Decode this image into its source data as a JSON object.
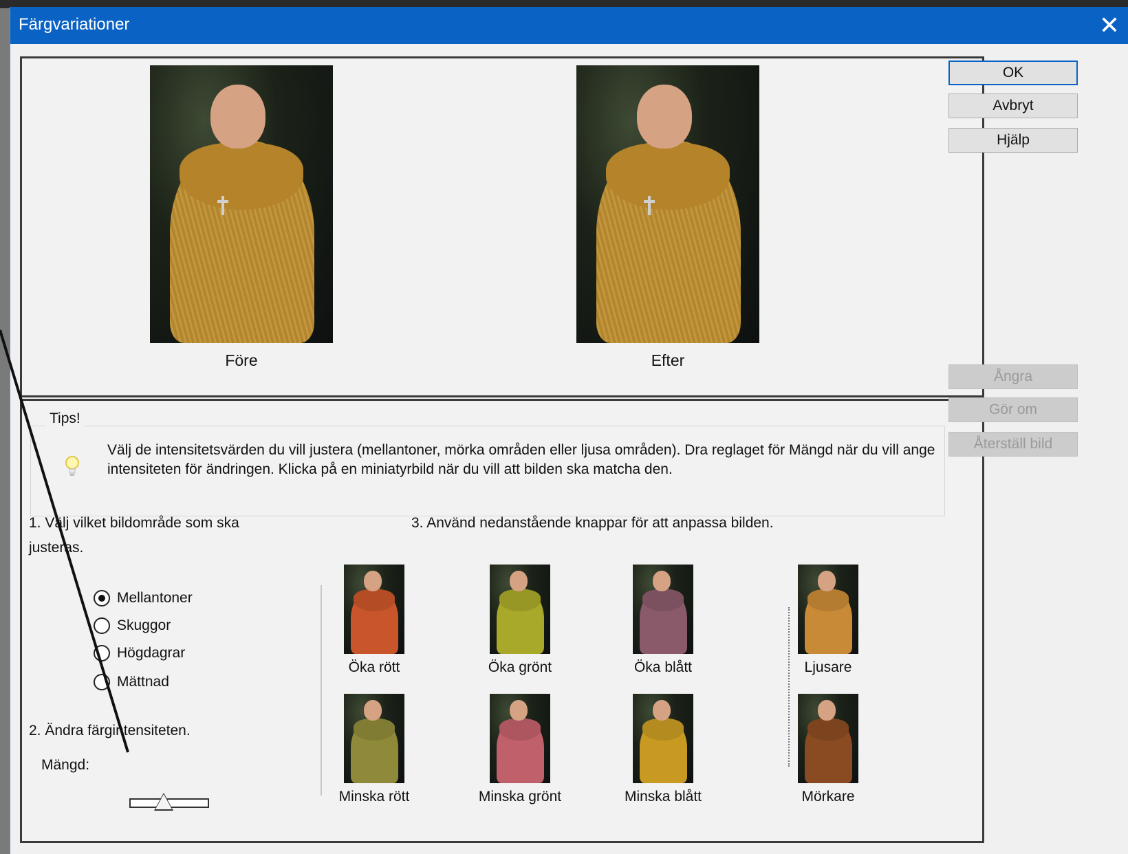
{
  "window": {
    "title": "Färgvariationer"
  },
  "preview": {
    "before_label": "Före",
    "after_label": "Efter"
  },
  "tips": {
    "title": "Tips!",
    "text": "Välj de intensitetsvärden du vill justera (mellantoner, mörka områden eller ljusa områden). Dra reglaget för Mängd när du vill ange intensiteten för ändringen. Klicka på en miniatyrbild när du vill att bilden ska matcha den."
  },
  "step1": {
    "label": "1. Välj vilket bildområde som ska justeras.",
    "options": [
      "Mellantoner",
      "Skuggor",
      "Högdagrar",
      "Mättnad"
    ],
    "selected": "Mellantoner"
  },
  "step2": {
    "label": "2. Ändra färgintensiteten.",
    "amount_label": "Mängd:",
    "amount_value": 0.5
  },
  "step3": {
    "label": "3. Använd nedanstående knappar för att anpassa bilden."
  },
  "thumbnails": [
    {
      "label": "Öka rött",
      "tint": "#c8562a"
    },
    {
      "label": "Öka grönt",
      "tint": "#a8a82a"
    },
    {
      "label": "Öka blått",
      "tint": "#8a5a6a"
    },
    {
      "label": "Ljusare",
      "tint": "#c88a36"
    },
    {
      "label": "Minska rött",
      "tint": "#8e8a3a"
    },
    {
      "label": "Minska grönt",
      "tint": "#c0606a"
    },
    {
      "label": "Minska blått",
      "tint": "#c89a22"
    },
    {
      "label": "Mörkare",
      "tint": "#8a4a22"
    }
  ],
  "buttons": {
    "ok": "OK",
    "cancel": "Avbryt",
    "help": "Hjälp",
    "undo": "Ångra",
    "redo": "Gör om",
    "reset": "Återställ bild"
  }
}
